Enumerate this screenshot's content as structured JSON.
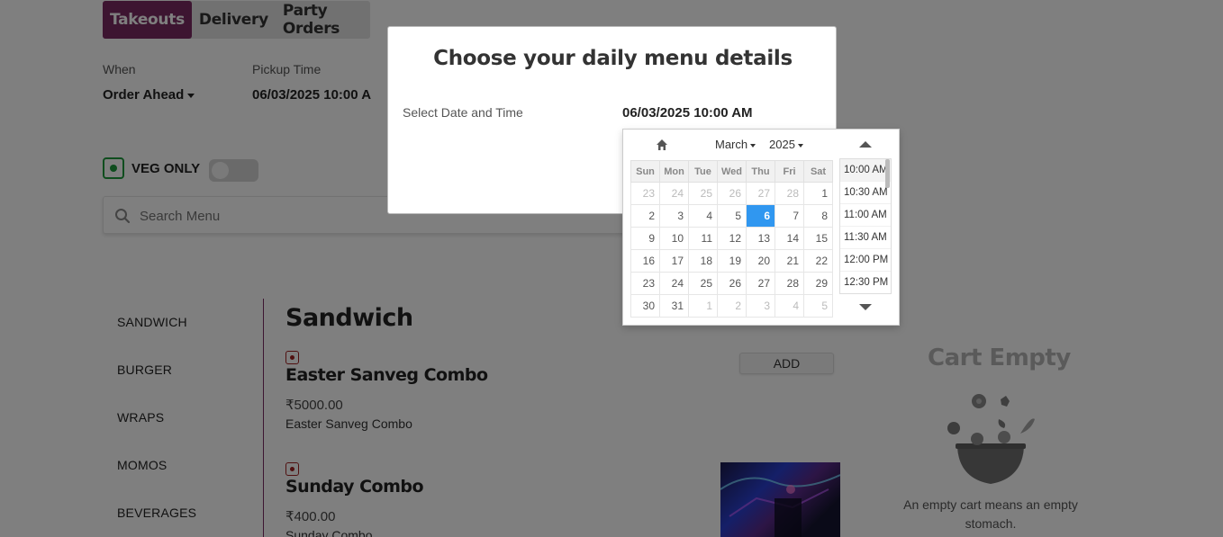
{
  "tabs": [
    {
      "label": "Takeouts",
      "active": true
    },
    {
      "label": "Delivery",
      "active": false
    },
    {
      "label": "Party Orders",
      "active": false
    }
  ],
  "when": {
    "label": "When",
    "value": "Order Ahead"
  },
  "pickup": {
    "label": "Pickup Time",
    "value": "06/03/2025 10:00 A"
  },
  "veg_only": {
    "label": "VEG ONLY",
    "on": false
  },
  "search": {
    "placeholder": "Search Menu"
  },
  "categories": [
    "SANDWICH",
    "BURGER",
    "WRAPS",
    "MOMOS",
    "BEVERAGES"
  ],
  "section": {
    "title": "Sandwich"
  },
  "items": [
    {
      "name": "Easter Sanveg Combo",
      "price": "₹5000.00",
      "description": "Easter Sanveg Combo",
      "add_label": "ADD"
    },
    {
      "name": "Sunday Combo",
      "price": "₹400.00",
      "description": "Sunday Combo"
    }
  ],
  "cart": {
    "title": "Cart Empty",
    "message": "An empty cart means an empty stomach."
  },
  "modal": {
    "title": "Choose your daily menu details",
    "label": "Select Date and Time",
    "input_value": "06/03/2025 10:00 AM"
  },
  "datepicker": {
    "month": "March",
    "year": "2025",
    "weekdays": [
      "Sun",
      "Mon",
      "Tue",
      "Wed",
      "Thu",
      "Fri",
      "Sat"
    ],
    "weeks": [
      [
        {
          "d": "23",
          "o": true
        },
        {
          "d": "24",
          "o": true
        },
        {
          "d": "25",
          "o": true
        },
        {
          "d": "26",
          "o": true
        },
        {
          "d": "27",
          "o": true
        },
        {
          "d": "28",
          "o": true
        },
        {
          "d": "1"
        }
      ],
      [
        {
          "d": "2"
        },
        {
          "d": "3"
        },
        {
          "d": "4"
        },
        {
          "d": "5"
        },
        {
          "d": "6",
          "s": true
        },
        {
          "d": "7"
        },
        {
          "d": "8"
        }
      ],
      [
        {
          "d": "9"
        },
        {
          "d": "10"
        },
        {
          "d": "11"
        },
        {
          "d": "12"
        },
        {
          "d": "13"
        },
        {
          "d": "14"
        },
        {
          "d": "15"
        }
      ],
      [
        {
          "d": "16"
        },
        {
          "d": "17"
        },
        {
          "d": "18"
        },
        {
          "d": "19"
        },
        {
          "d": "20"
        },
        {
          "d": "21"
        },
        {
          "d": "22"
        }
      ],
      [
        {
          "d": "23"
        },
        {
          "d": "24"
        },
        {
          "d": "25"
        },
        {
          "d": "26"
        },
        {
          "d": "27"
        },
        {
          "d": "28"
        },
        {
          "d": "29"
        }
      ],
      [
        {
          "d": "30"
        },
        {
          "d": "31"
        },
        {
          "d": "1",
          "o": true
        },
        {
          "d": "2",
          "o": true
        },
        {
          "d": "3",
          "o": true
        },
        {
          "d": "4",
          "o": true
        },
        {
          "d": "5",
          "o": true
        }
      ]
    ],
    "times": [
      "10:00 AM",
      "10:30 AM",
      "11:00 AM",
      "11:30 AM",
      "12:00 PM",
      "12:30 PM"
    ]
  },
  "colors": {
    "accent": "#7a2a62",
    "selected_day": "#3097f0",
    "veg": "#1e9a3c",
    "nonveg": "#a02020"
  }
}
